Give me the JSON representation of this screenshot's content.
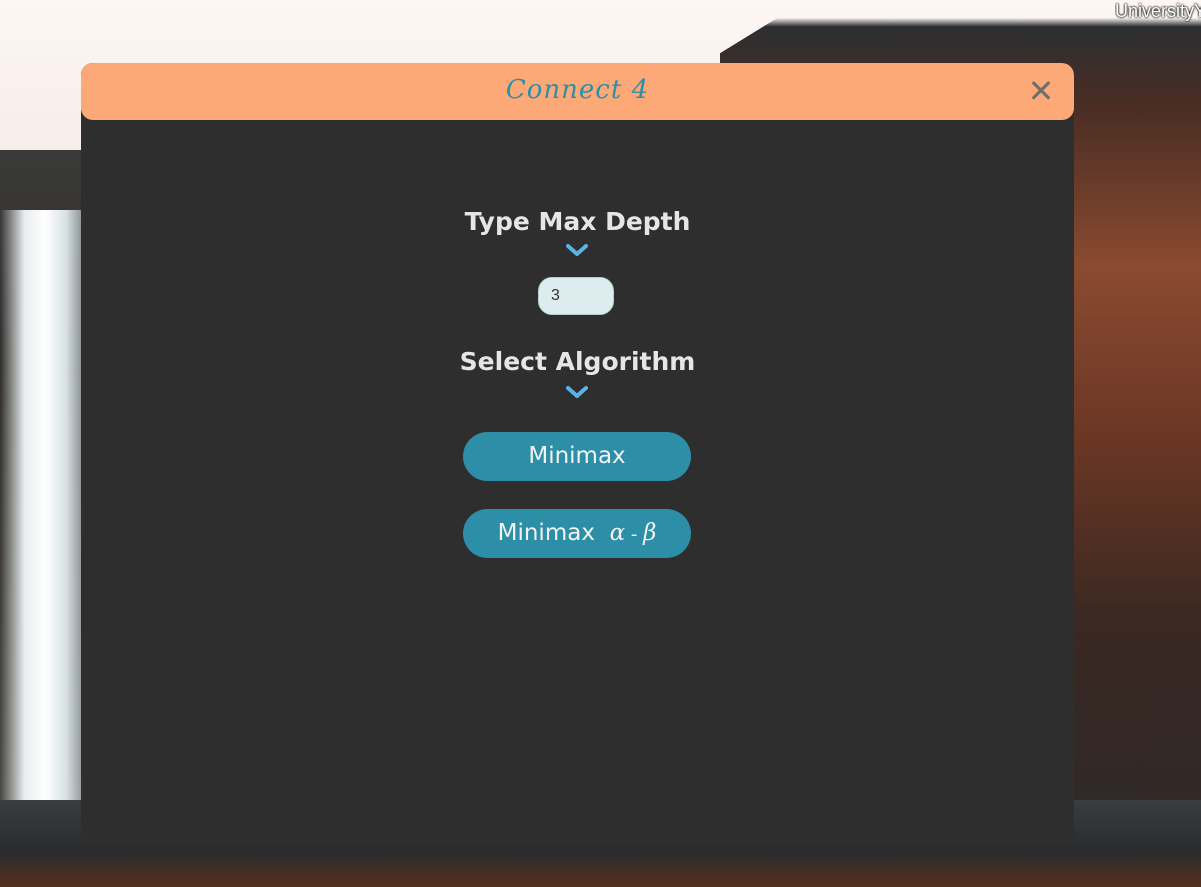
{
  "desktop": {
    "corner_text": "UniversityY"
  },
  "window": {
    "title": "Connect 4",
    "close_symbol": "✕"
  },
  "depth_section": {
    "heading": "Type Max Depth",
    "chevron_icon": "chevron-down-icon",
    "input_value": "3"
  },
  "algorithm_section": {
    "heading": "Select Algorithm",
    "chevron_icon": "chevron-down-icon",
    "buttons": [
      {
        "label": "Minimax"
      },
      {
        "label": "Minimax",
        "suffix_alpha": "α",
        "suffix_sep": " - ",
        "suffix_beta": "β"
      }
    ]
  },
  "colors": {
    "titlebar": "#fda977",
    "title_text": "#2d8ea8",
    "panel": "#2e2e2e",
    "button": "#2d8ea8",
    "chevron": "#5bb3e6",
    "input_bg": "#ddecee"
  }
}
